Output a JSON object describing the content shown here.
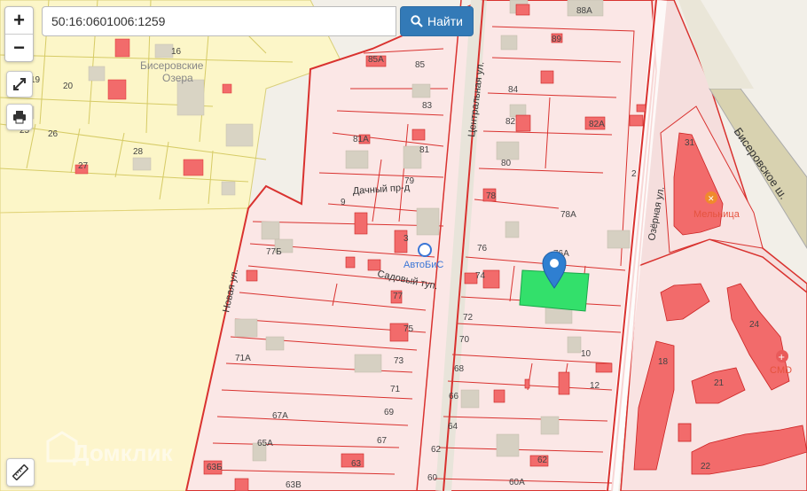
{
  "search": {
    "value": "50:16:0601006:1259",
    "button_label": "Найти"
  },
  "controls": {
    "zoom_in": "+",
    "zoom_out": "−"
  },
  "watermark": "Домклик",
  "map": {
    "settlement": "Бисеровские Озера",
    "settlement_line1": "Бисеровские",
    "settlement_line2": "Озера",
    "streets": {
      "central": "Центральная ул.",
      "dachny": "Дачный пр-д",
      "sadovy": "Садовый туп.",
      "novaya": "Новая ул.",
      "ozernaya": "Озёрная ул.",
      "biserovskoe": "Бисеровское ш."
    },
    "pois": {
      "melnitsa": "Мельница",
      "avtobis": "АвтоБиС",
      "cmd": "CMD"
    },
    "house_numbers": {
      "n88a": "88А",
      "n85a": "85А",
      "n85": "85",
      "n89": "89",
      "n84": "84",
      "n83": "83",
      "n82": "82",
      "n82a": "82А",
      "n81": "81",
      "n81a": "81А",
      "n80": "80",
      "n79": "79",
      "n78": "78",
      "n78a": "78А",
      "n76": "76",
      "n76a": "76А",
      "n77b": "77Б",
      "n77": "77",
      "n74": "74",
      "n72": "72",
      "n70": "70",
      "n68": "68",
      "n66": "66",
      "n64": "64",
      "n62": "62",
      "n60": "60",
      "n60a": "60А",
      "n75": "75",
      "n73": "73",
      "n71": "71",
      "n71a": "71А",
      "n69": "69",
      "n67": "67",
      "n67a": "67А",
      "n65a": "65А",
      "n63": "63",
      "n63b": "63Б",
      "n63v": "63В",
      "n9": "9",
      "n3": "3",
      "n2": "2",
      "n10": "10",
      "n12": "12",
      "n16": "16",
      "n20": "20",
      "n19": "19",
      "n25": "25",
      "n26": "26",
      "n27": "27",
      "n28": "28",
      "n21": "21",
      "n18": "18",
      "n22": "22",
      "n31": "31",
      "n24": "24",
      "n64b": "64",
      "n62b": "62",
      "n79b": "79"
    }
  }
}
